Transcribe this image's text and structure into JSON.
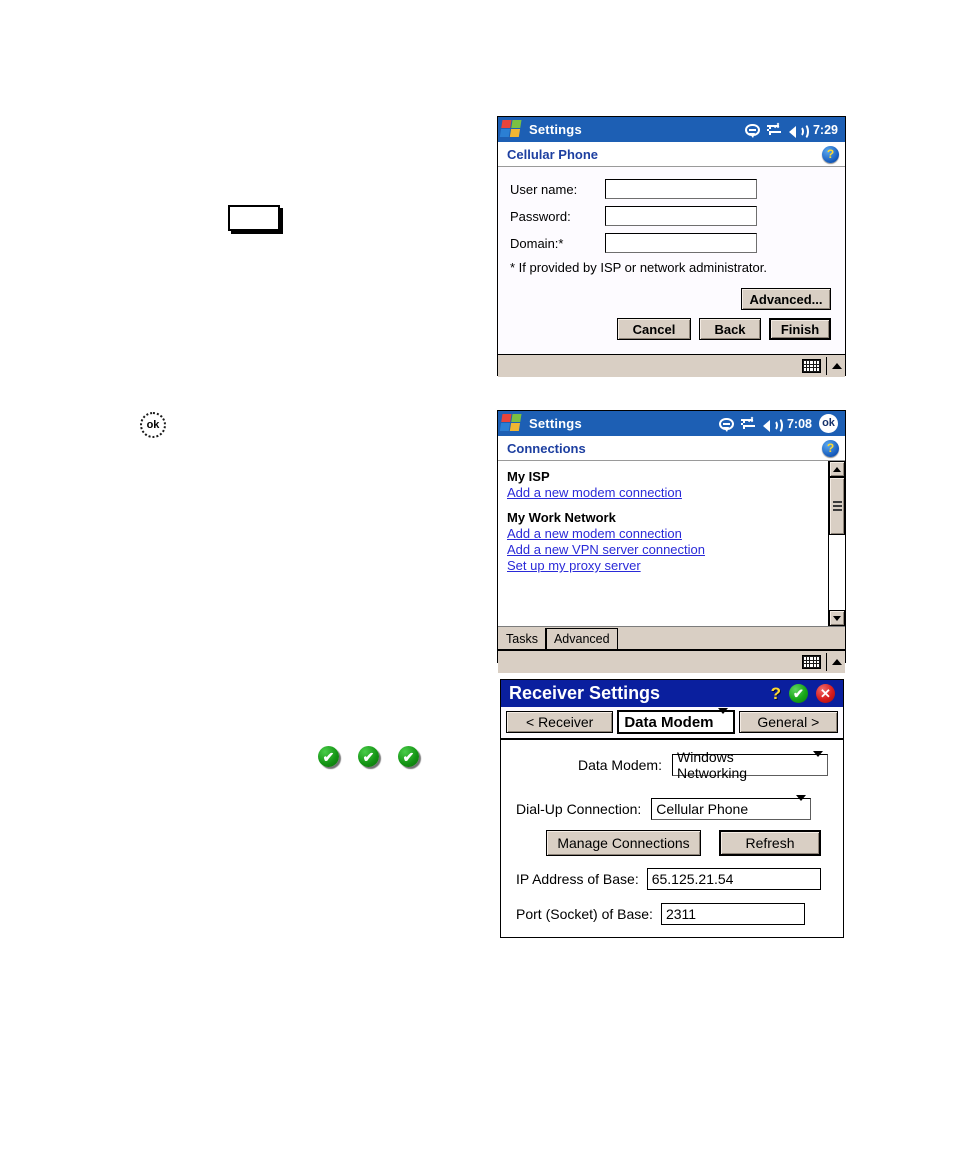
{
  "window_cellular": {
    "titlebar": {
      "app_title": "Settings",
      "clock": "7:29",
      "icons": [
        "windows-flag-icon",
        "chat-bubble-icon",
        "network-connection-icon",
        "volume-speaker-icon"
      ]
    },
    "page_header": {
      "caption": "Cellular Phone",
      "help_icon": "?"
    },
    "fields": [
      {
        "label": "User name:",
        "value": ""
      },
      {
        "label": "Password:",
        "value": ""
      },
      {
        "label": "Domain:*",
        "value": ""
      }
    ],
    "footnote": "* If provided by ISP or network administrator.",
    "buttons": {
      "advanced": "Advanced...",
      "cancel": "Cancel",
      "back": "Back",
      "finish": "Finish"
    },
    "sipbar": {
      "keyboard_icon": "keyboard-icon",
      "arrow_icon": "up-arrow-icon"
    }
  },
  "window_connections": {
    "titlebar": {
      "app_title": "Settings",
      "clock": "7:08",
      "ok_label": "ok"
    },
    "page_header": {
      "caption": "Connections",
      "help_icon": "?"
    },
    "groups": [
      {
        "title": "My ISP",
        "links": [
          "Add a new modem connection"
        ]
      },
      {
        "title": "My Work Network",
        "links": [
          "Add a new modem connection",
          "Add a new VPN server connection",
          "Set up my proxy server"
        ]
      }
    ],
    "tabs": [
      {
        "label": "Tasks",
        "active": true
      },
      {
        "label": "Advanced",
        "active": false
      }
    ],
    "sipbar": {
      "keyboard_icon": "keyboard-icon",
      "arrow_icon": "up-arrow-icon"
    }
  },
  "window_receiver": {
    "titlebar": {
      "title": "Receiver Settings",
      "help_icon": "?",
      "ok_icon": "✔",
      "close_icon": "✕"
    },
    "navbar": {
      "prev_label": "< Receiver",
      "current_page": "Data Modem",
      "next_label": "General >"
    },
    "form": {
      "data_modem_label": "Data Modem:",
      "data_modem_value": "Windows Networking",
      "dialup_label": "Dial-Up Connection:",
      "dialup_value": "Cellular Phone",
      "manage_button": "Manage Connections",
      "refresh_button": "Refresh",
      "ip_label": "IP Address of Base:",
      "ip_value": "65.125.21.54",
      "port_label": "Port (Socket) of Base:",
      "port_value": "2311"
    }
  },
  "annotations": {
    "empty_box": "",
    "ok_glyph": "ok",
    "check_glyph": "✔",
    "check_count": 3
  },
  "colors": {
    "titlebar_blue": "#1d5fb4",
    "receiver_title_blue": "#0a1f9e",
    "header_caption": "#1d3fa0",
    "link_blue": "#2a2ad8",
    "button_face": "#d9cfc4",
    "pane_bg": "#fdfbff",
    "check_green": "#149414",
    "close_red": "#d81c1c",
    "help_yellow": "#ffd92e"
  }
}
